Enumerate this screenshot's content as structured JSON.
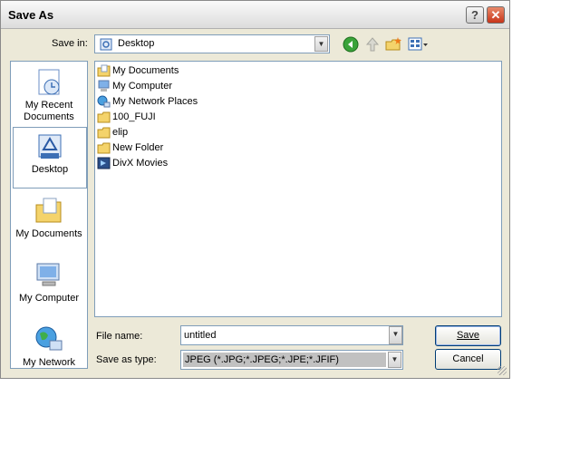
{
  "window": {
    "title": "Save As",
    "help_glyph": "?",
    "close_glyph": "✕"
  },
  "save_in": {
    "label": "Save in:",
    "value": "Desktop"
  },
  "toolbar": {
    "icons": [
      "back-icon",
      "up-folder-icon",
      "new-folder-icon",
      "views-menu-icon"
    ]
  },
  "places": [
    {
      "label": "My Recent Documents",
      "icon": "recent-documents-icon"
    },
    {
      "label": "Desktop",
      "icon": "desktop-icon"
    },
    {
      "label": "My Documents",
      "icon": "my-documents-icon"
    },
    {
      "label": "My Computer",
      "icon": "my-computer-icon"
    },
    {
      "label": "My Network",
      "icon": "my-network-icon"
    }
  ],
  "files": [
    {
      "name": "My Documents",
      "icon": "documents-folder-icon"
    },
    {
      "name": "My Computer",
      "icon": "computer-icon"
    },
    {
      "name": "My Network Places",
      "icon": "network-icon"
    },
    {
      "name": "100_FUJI",
      "icon": "folder-icon"
    },
    {
      "name": "elip",
      "icon": "folder-icon"
    },
    {
      "name": "New Folder",
      "icon": "folder-icon"
    },
    {
      "name": "DivX Movies",
      "icon": "shortcut-icon"
    }
  ],
  "file_name": {
    "label": "File name:",
    "value": "untitled"
  },
  "save_as_type": {
    "label": "Save as type:",
    "value": "JPEG (*.JPG;*.JPEG;*.JPE;*.JFIF)"
  },
  "buttons": {
    "save": "Save",
    "cancel": "Cancel"
  }
}
